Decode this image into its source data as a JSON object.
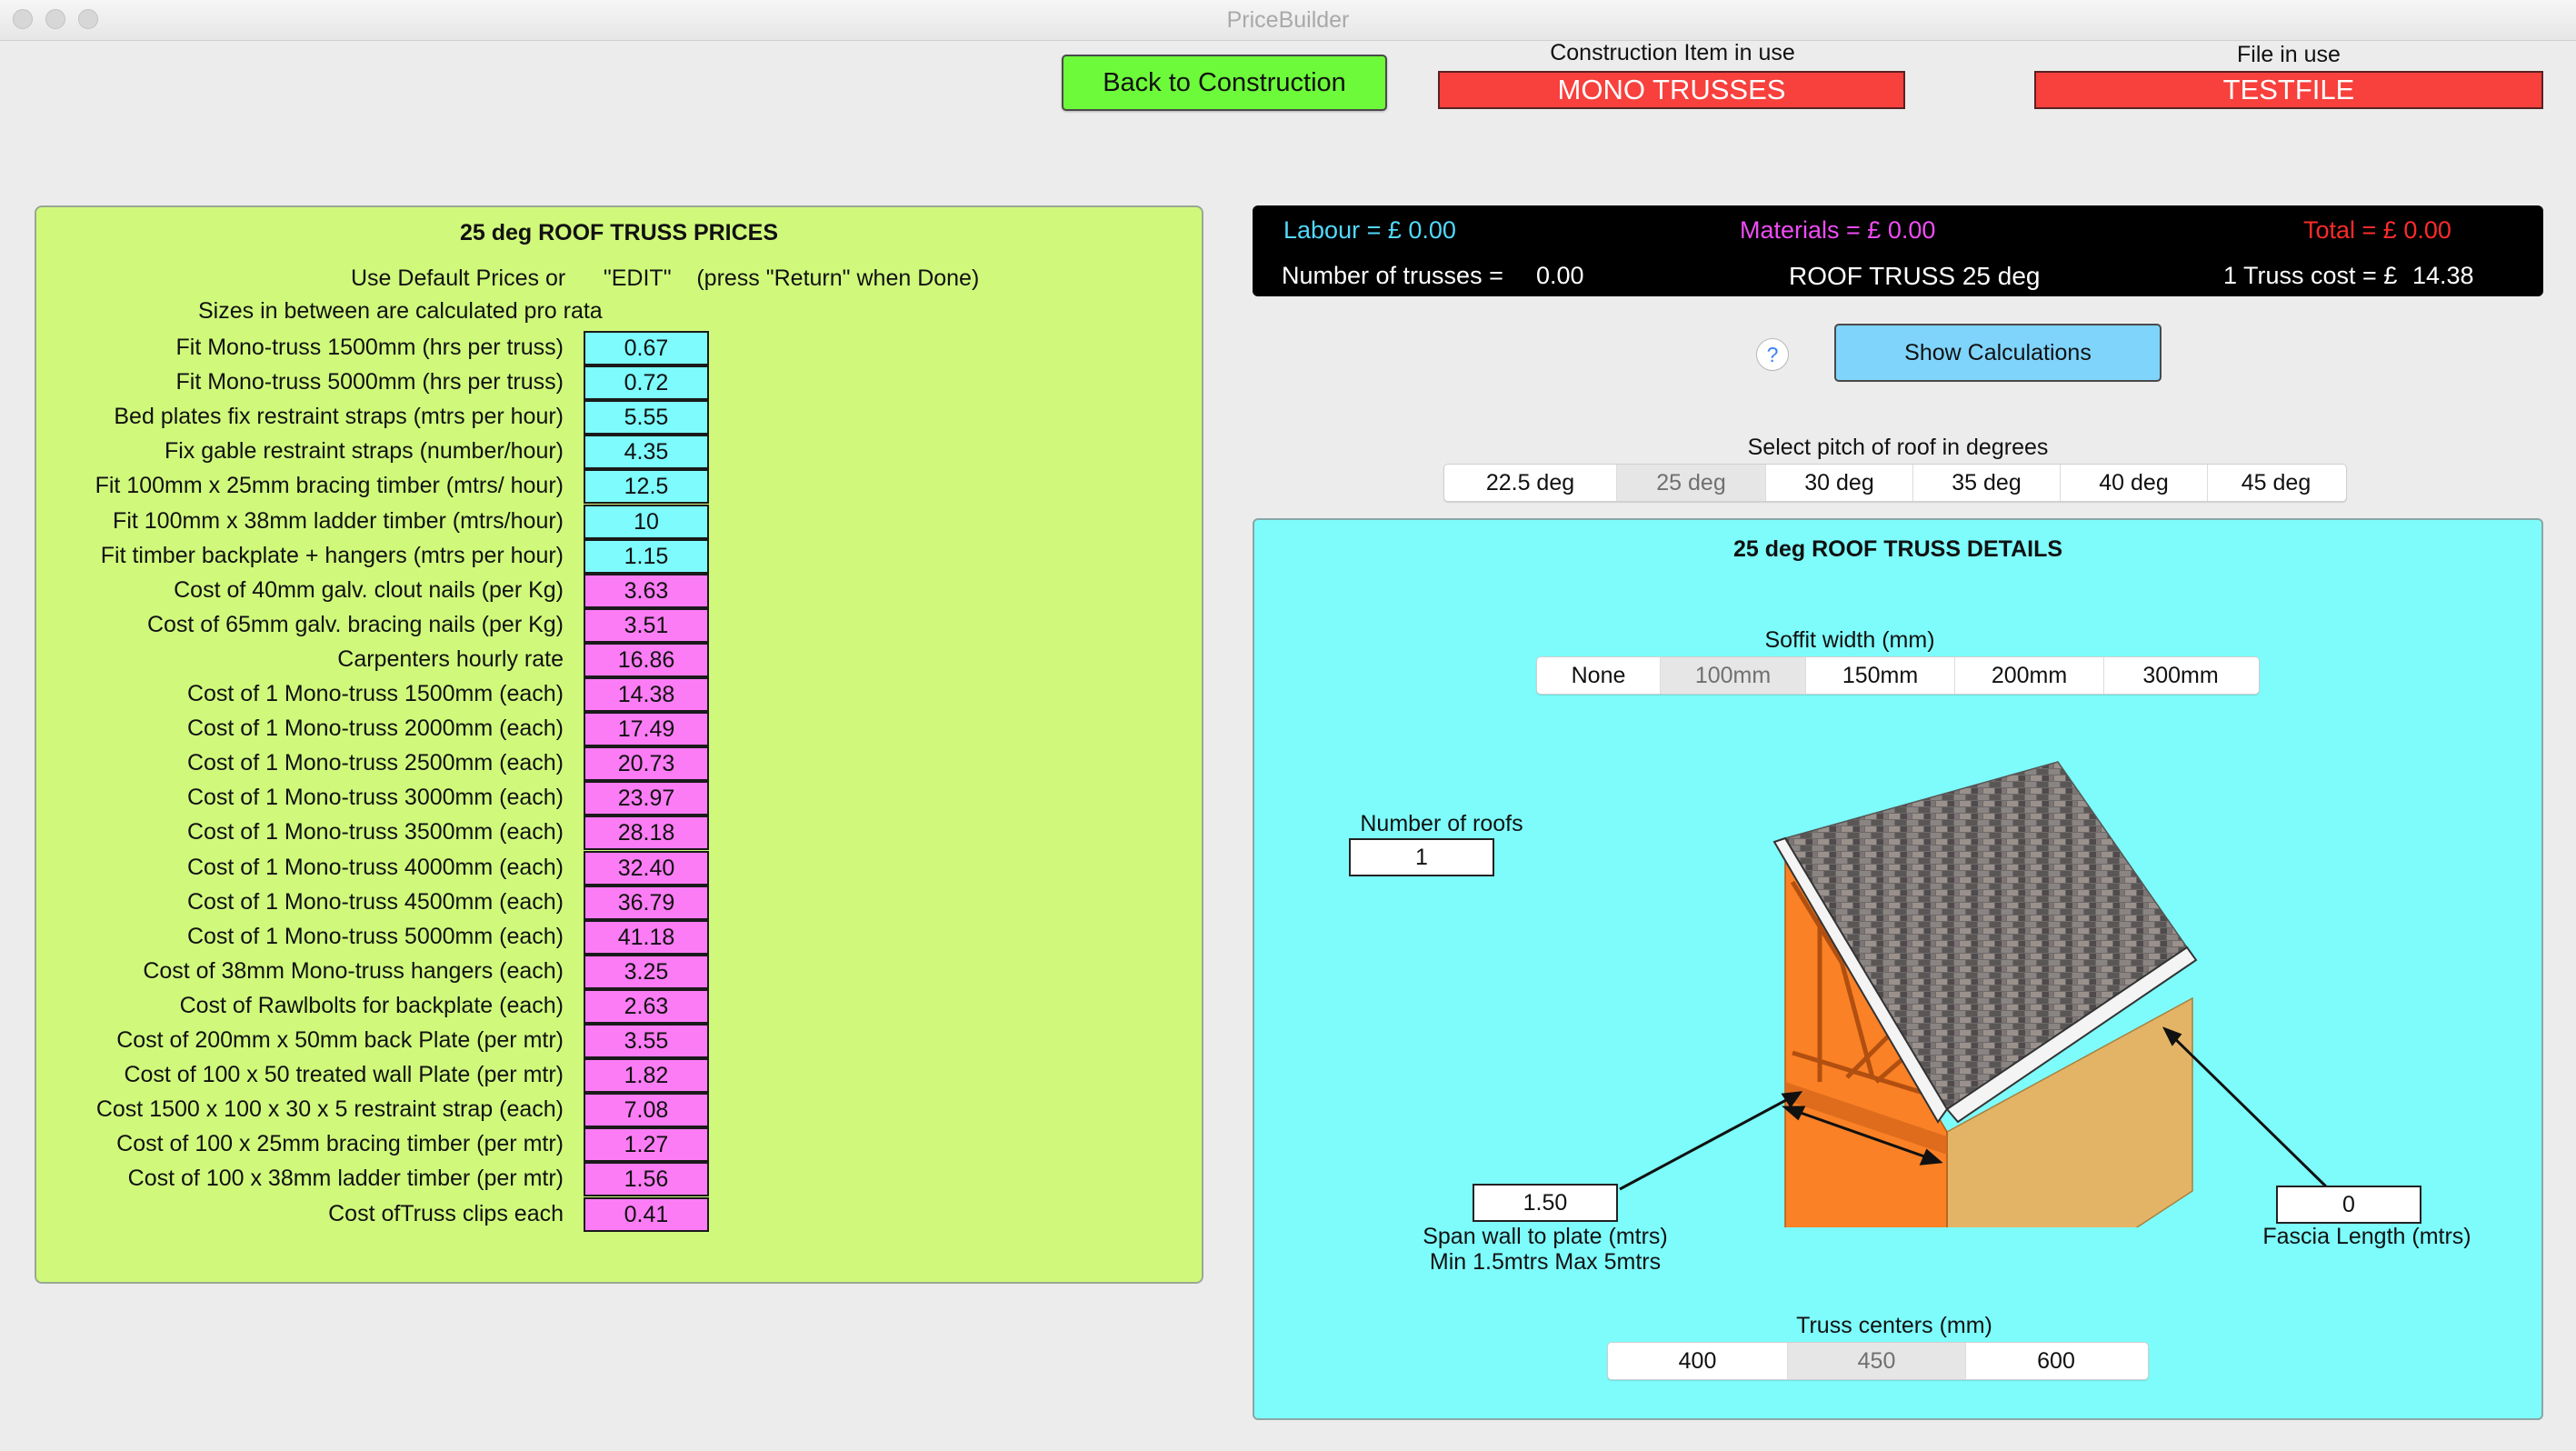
{
  "window": {
    "title": "PriceBuilder"
  },
  "header": {
    "back_button": "Back to Construction",
    "construction_label": "Construction Item in use",
    "construction_value": "MONO TRUSSES",
    "file_label": "File in use",
    "file_value": "TESTFILE"
  },
  "prices": {
    "title": "25 deg ROOF TRUSS PRICES",
    "instruction": "Use Default Prices or      \"EDIT\"    (press \"Return\" when Done)",
    "note": "Sizes in between are calculated pro rata",
    "rows": [
      {
        "label": "Fit Mono-truss 1500mm (hrs per truss)",
        "value": "0.67",
        "kind": "cyan"
      },
      {
        "label": "Fit Mono-truss 5000mm (hrs per truss)",
        "value": "0.72",
        "kind": "cyan"
      },
      {
        "label": "Bed plates fix restraint straps (mtrs per hour)",
        "value": "5.55",
        "kind": "cyan"
      },
      {
        "label": "Fix gable restraint straps (number/hour)",
        "value": "4.35",
        "kind": "cyan"
      },
      {
        "label": "Fit 100mm x 25mm bracing timber (mtrs/ hour)",
        "value": "12.5",
        "kind": "cyan"
      },
      {
        "label": "Fit 100mm x 38mm ladder timber (mtrs/hour)",
        "value": "10",
        "kind": "cyan"
      },
      {
        "label": "Fit timber backplate + hangers (mtrs per hour)",
        "value": "1.15",
        "kind": "cyan"
      },
      {
        "label": "Cost of 40mm galv. clout nails (per Kg)",
        "value": "3.63",
        "kind": "pink"
      },
      {
        "label": "Cost of 65mm galv. bracing nails (per Kg)",
        "value": "3.51",
        "kind": "pink"
      },
      {
        "label": "Carpenters hourly rate",
        "value": "16.86",
        "kind": "pink"
      },
      {
        "label": "Cost of 1 Mono-truss 1500mm (each)",
        "value": "14.38",
        "kind": "pink"
      },
      {
        "label": "Cost of 1 Mono-truss 2000mm (each)",
        "value": "17.49",
        "kind": "pink"
      },
      {
        "label": "Cost of 1 Mono-truss 2500mm (each)",
        "value": "20.73",
        "kind": "pink"
      },
      {
        "label": "Cost of 1 Mono-truss 3000mm (each)",
        "value": "23.97",
        "kind": "pink"
      },
      {
        "label": "Cost of 1 Mono-truss 3500mm (each)",
        "value": "28.18",
        "kind": "pink"
      },
      {
        "label": "Cost of 1 Mono-truss 4000mm (each)",
        "value": "32.40",
        "kind": "pink"
      },
      {
        "label": "Cost of 1 Mono-truss 4500mm (each)",
        "value": "36.79",
        "kind": "pink"
      },
      {
        "label": "Cost of 1 Mono-truss 5000mm (each)",
        "value": "41.18",
        "kind": "pink"
      },
      {
        "label": "Cost of 38mm Mono-truss hangers (each)",
        "value": "3.25",
        "kind": "pink"
      },
      {
        "label": "Cost of Rawlbolts for backplate (each)",
        "value": "2.63",
        "kind": "pink"
      },
      {
        "label": "Cost of 200mm x 50mm back Plate (per mtr)",
        "value": "3.55",
        "kind": "pink"
      },
      {
        "label": "Cost of 100 x 50 treated wall Plate (per mtr)",
        "value": "1.82",
        "kind": "pink"
      },
      {
        "label": "Cost 1500 x 100 x 30 x 5 restraint strap (each)",
        "value": "7.08",
        "kind": "pink"
      },
      {
        "label": "Cost of 100 x 25mm bracing timber (per mtr)",
        "value": "1.27",
        "kind": "pink"
      },
      {
        "label": "Cost of 100 x 38mm ladder timber (per mtr)",
        "value": "1.56",
        "kind": "pink"
      },
      {
        "label": "Cost ofTruss clips each",
        "value": "0.41",
        "kind": "pink"
      }
    ]
  },
  "summary": {
    "labour": "Labour = £  0.00",
    "materials": "Materials = £  0.00",
    "total": "Total = £  0.00",
    "trusses_label": "Number of trusses =",
    "trusses_value": "0.00",
    "item_name": "ROOF TRUSS 25 deg",
    "truss_cost_label": "1 Truss cost = £",
    "truss_cost_value": "14.38",
    "colors": {
      "labour": "#52d9fb",
      "materials": "#f04cf5",
      "total": "#fb2b2b"
    }
  },
  "help": {
    "icon": "?"
  },
  "show_calc": "Show Calculations",
  "pitch": {
    "label": "Select pitch of roof in degrees",
    "options": [
      "22.5 deg",
      "25 deg",
      "30 deg",
      "35 deg",
      "40 deg",
      "45 deg"
    ],
    "selected": "25 deg"
  },
  "details": {
    "title": "25 deg ROOF TRUSS DETAILS",
    "soffit_label": "Soffit width (mm)",
    "soffit_options": [
      "None",
      "100mm",
      "150mm",
      "200mm",
      "300mm"
    ],
    "soffit_selected": "100mm",
    "roofs_label": "Number of roofs",
    "roofs_value": "1",
    "span_value": "1.50",
    "span_label": "Span wall to plate (mtrs)",
    "span_note": "Min 1.5mtrs Max 5mtrs",
    "fascia_value": "0",
    "fascia_label": "Fascia Length (mtrs)",
    "centers_label": "Truss centers (mm)",
    "centers_options": [
      "400",
      "450",
      "600"
    ],
    "centers_selected": "450"
  }
}
